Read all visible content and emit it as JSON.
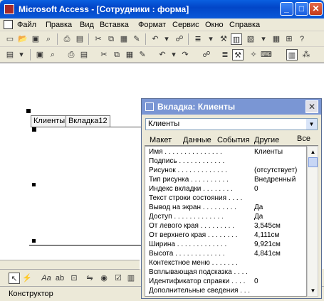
{
  "window": {
    "title": "Microsoft Access - [Сотрудники : форма]",
    "minimize": "_",
    "maximize": "□",
    "close": "✕"
  },
  "menu": [
    "Файл",
    "Правка",
    "Вид",
    "Вставка",
    "Формат",
    "Сервис",
    "Окно",
    "Справка"
  ],
  "design": {
    "tabs": [
      "Клиенты",
      "Вкладка12"
    ]
  },
  "status": "Конструктор",
  "toolbox": {
    "label_tool": "Aa",
    "textbox_tool": "ab"
  },
  "property_sheet": {
    "title": "Вкладка: Клиенты",
    "selected_object": "Клиенты",
    "tabs": [
      "Макет",
      "Данные",
      "События",
      "Другие",
      "Все"
    ],
    "rows": [
      {
        "label": "Имя . . . . . . . . . . . . . . .",
        "value": "Клиенты"
      },
      {
        "label": "Подпись . . . . . . . . . . . .",
        "value": ""
      },
      {
        "label": "Рисунок . . . . . . . . . . . . .",
        "value": "(отсутствует)"
      },
      {
        "label": "Тип рисунка . . . . . . . . . .",
        "value": "Внедренный"
      },
      {
        "label": "Индекс вкладки . . . . . . . .",
        "value": "0"
      },
      {
        "label": "Текст строки состояния . . . .",
        "value": ""
      },
      {
        "label": "Вывод на экран . . . . . . . . .",
        "value": "Да"
      },
      {
        "label": "Доступ . . . . . . . . . . . . .",
        "value": "Да"
      },
      {
        "label": "От левого края . . . . . . . . .",
        "value": "3,545см"
      },
      {
        "label": "От верхнего края . . . . . . . .",
        "value": "4,111см"
      },
      {
        "label": "Ширина . . . . . . . . . . . . .",
        "value": "9,921см"
      },
      {
        "label": "Высота . . . . . . . . . . . . .",
        "value": "4,841см"
      },
      {
        "label": "Контекстное меню . . . . . . .",
        "value": ""
      },
      {
        "label": "Всплывающая подсказка . . . .",
        "value": ""
      },
      {
        "label": "Идентификатор справки . . . .",
        "value": "0"
      },
      {
        "label": "Дополнительные сведения . . .",
        "value": ""
      }
    ]
  }
}
